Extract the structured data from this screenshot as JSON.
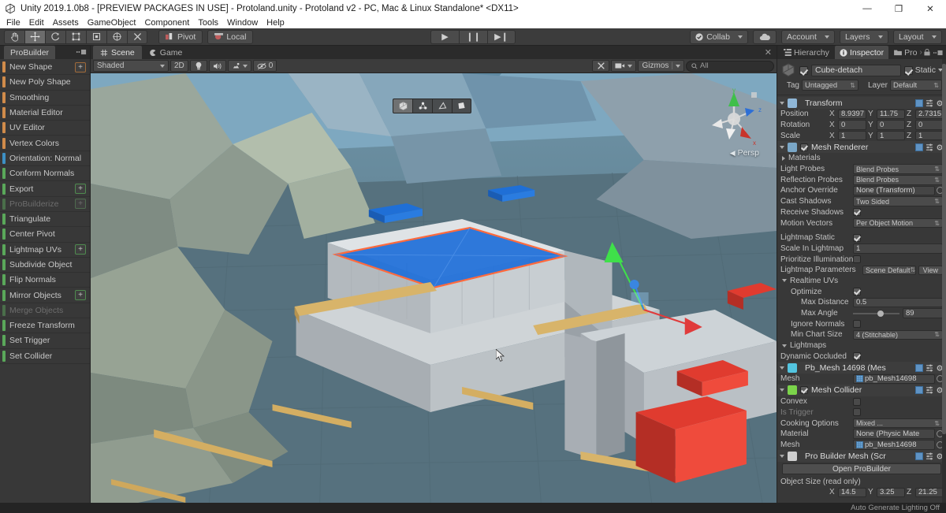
{
  "window": {
    "title": "Unity 2019.1.0b8 - [PREVIEW PACKAGES IN USE] - Protoland.unity - Protoland v2 - PC, Mac & Linux Standalone* <DX11>",
    "minimize": "—",
    "maximize": "❐",
    "close": "✕"
  },
  "menubar": {
    "items": [
      "File",
      "Edit",
      "Assets",
      "GameObject",
      "Component",
      "Tools",
      "Window",
      "Help"
    ]
  },
  "toolbar": {
    "tools": [
      {
        "name": "hand-tool",
        "glyph": "✋",
        "active": false
      },
      {
        "name": "move-tool",
        "glyph": "✥",
        "active": true
      },
      {
        "name": "rotate-tool",
        "glyph": "↻",
        "active": false
      },
      {
        "name": "scale-tool",
        "glyph": "⤢",
        "active": false
      },
      {
        "name": "rect-tool",
        "glyph": "▣",
        "active": false
      },
      {
        "name": "transform-tool",
        "glyph": "⌖",
        "active": false
      },
      {
        "name": "custom-editor-tool",
        "glyph": "⚒",
        "active": false
      }
    ],
    "pivot_label": "Pivot",
    "local_label": "Local",
    "play_label": "▶",
    "pause_label": "❙❙",
    "step_label": "▶❙",
    "collab_label": "Collab",
    "cloud_label": "☁",
    "account_label": "Account",
    "layers_label": "Layers",
    "layout_label": "Layout"
  },
  "probuilder": {
    "tab_label": "ProBuilder",
    "items": [
      {
        "label": "New Shape",
        "color": "#d08b4a",
        "plus": true,
        "dim": false
      },
      {
        "label": "New Poly Shape",
        "color": "#d08b4a",
        "plus": false,
        "dim": false
      },
      {
        "label": "Smoothing",
        "color": "#d08b4a",
        "plus": false,
        "dim": false
      },
      {
        "label": "Material Editor",
        "color": "#d08b4a",
        "plus": false,
        "dim": false
      },
      {
        "label": "UV Editor",
        "color": "#d08b4a",
        "plus": false,
        "dim": false
      },
      {
        "label": "Vertex Colors",
        "color": "#d08b4a",
        "plus": false,
        "dim": false
      },
      {
        "label": "Orientation: Normal",
        "color": "#3d90c4",
        "plus": false,
        "dim": false
      },
      {
        "label": "Conform Normals",
        "color": "#5aa85a",
        "plus": false,
        "dim": false
      },
      {
        "label": "Export",
        "color": "#5aa85a",
        "plus": true,
        "dim": false
      },
      {
        "label": "ProBuilderize",
        "color": "#4a6e4a",
        "plus": true,
        "dim": true
      },
      {
        "label": "Triangulate",
        "color": "#5aa85a",
        "plus": false,
        "dim": false
      },
      {
        "label": "Center Pivot",
        "color": "#5aa85a",
        "plus": false,
        "dim": false
      },
      {
        "label": "Lightmap UVs",
        "color": "#5aa85a",
        "plus": true,
        "dim": false
      },
      {
        "label": "Subdivide Object",
        "color": "#5aa85a",
        "plus": false,
        "dim": false
      },
      {
        "label": "Flip Normals",
        "color": "#5aa85a",
        "plus": false,
        "dim": false
      },
      {
        "label": "Mirror Objects",
        "color": "#5aa85a",
        "plus": true,
        "dim": false
      },
      {
        "label": "Merge Objects",
        "color": "#4a6e4a",
        "plus": false,
        "dim": true
      },
      {
        "label": "Freeze Transform",
        "color": "#5aa85a",
        "plus": false,
        "dim": false
      },
      {
        "label": "Set Trigger",
        "color": "#5aa85a",
        "plus": false,
        "dim": false
      },
      {
        "label": "Set Collider",
        "color": "#5aa85a",
        "plus": false,
        "dim": false
      }
    ]
  },
  "scene": {
    "tabs": [
      {
        "label": "Scene",
        "active": true
      },
      {
        "label": "Game",
        "active": false
      }
    ],
    "shading_mode": "Shaded",
    "mode_2d": "2D",
    "lighting_icon": "☀",
    "audio_icon": "◂))",
    "fx_icon": "☄",
    "effects_count": "0",
    "tools_icon": "⚒",
    "camera_icon": "■",
    "gizmos_label": "Gizmos",
    "search_placeholder": "All",
    "search_value": "All",
    "close_tab_icon": "✕",
    "persp_label": "Persp",
    "axis_x": "x",
    "axis_y": "y",
    "axis_z": "z",
    "element_modes": [
      {
        "name": "object-mode",
        "active": true
      },
      {
        "name": "vertex-mode",
        "active": false
      },
      {
        "name": "edge-mode",
        "active": false
      },
      {
        "name": "face-mode",
        "active": false
      }
    ]
  },
  "inspector": {
    "tabs": [
      {
        "label": "Hierarchy",
        "active": false
      },
      {
        "label": "Inspector",
        "active": true
      },
      {
        "label": "Pro",
        "active": false
      }
    ],
    "object": {
      "enabled": true,
      "name": "Cube-detach",
      "static_label": "Static",
      "static_checked": true,
      "tag_label": "Tag",
      "tag_value": "Untagged",
      "layer_label": "Layer",
      "layer_value": "Default"
    },
    "components": [
      {
        "title": "Transform",
        "icon_color": "#8fb7d8",
        "rows": [
          {
            "type": "vector3",
            "label": "Position",
            "x": "8.9397",
            "y": "11.75",
            "z": "2.7315"
          },
          {
            "type": "vector3",
            "label": "Rotation",
            "x": "0",
            "y": "0",
            "z": "0"
          },
          {
            "type": "vector3",
            "label": "Scale",
            "x": "1",
            "y": "1",
            "z": "1"
          }
        ]
      },
      {
        "title": "Mesh Renderer",
        "icon_color": "#7aa7c7",
        "has_enable": true,
        "enabled": true,
        "rows": [
          {
            "type": "foldout",
            "label": "Materials"
          },
          {
            "type": "dropdown",
            "label": "Light Probes",
            "value": "Blend Probes"
          },
          {
            "type": "dropdown",
            "label": "Reflection Probes",
            "value": "Blend Probes"
          },
          {
            "type": "object",
            "label": "Anchor Override",
            "value": "None (Transform)"
          },
          {
            "type": "dropdown",
            "label": "Cast Shadows",
            "value": "Two Sided"
          },
          {
            "type": "check",
            "label": "Receive Shadows",
            "value": true
          },
          {
            "type": "dropdown",
            "label": "Motion Vectors",
            "value": "Per Object Motion"
          },
          {
            "type": "spacer"
          },
          {
            "type": "check",
            "label": "Lightmap Static",
            "value": true
          },
          {
            "type": "text",
            "label": "Scale In Lightmap",
            "value": "1"
          },
          {
            "type": "check",
            "label": "Prioritize Illumination",
            "value": false
          },
          {
            "type": "ddview",
            "label": "Lightmap Parameters",
            "value": "Scene Default",
            "button": "View"
          },
          {
            "type": "foldout-open",
            "label": "Realtime UVs"
          },
          {
            "type": "check",
            "label": "Optimize",
            "value": true,
            "indent": 1
          },
          {
            "type": "text",
            "label": "Max Distance",
            "value": "0.5",
            "indent": 2
          },
          {
            "type": "slider",
            "label": "Max Angle",
            "value": "89",
            "indent": 2
          },
          {
            "type": "check",
            "label": "Ignore Normals",
            "value": false,
            "indent": 1
          },
          {
            "type": "dropdown",
            "label": "Min Chart Size",
            "value": "4 (Stitchable)",
            "indent": 1
          },
          {
            "type": "foldout-open",
            "label": "Lightmaps"
          },
          {
            "type": "check",
            "label": "Dynamic Occluded",
            "value": true
          }
        ]
      },
      {
        "title": "Pb_Mesh 14698 (Mes",
        "icon_color": "#53c5e0",
        "rows": [
          {
            "type": "object",
            "label": "Mesh",
            "value": "pb_Mesh14698",
            "has_mesh_icon": true
          }
        ]
      },
      {
        "title": "Mesh Collider",
        "icon_color": "#7bd44a",
        "has_enable": true,
        "enabled": true,
        "rows": [
          {
            "type": "check",
            "label": "Convex",
            "value": false
          },
          {
            "type": "check",
            "label": "Is Trigger",
            "value": false,
            "dim": true
          },
          {
            "type": "dropdown",
            "label": "Cooking Options",
            "value": "Mixed ..."
          },
          {
            "type": "object",
            "label": "Material",
            "value": "None (Physic Mate"
          },
          {
            "type": "object",
            "label": "Mesh",
            "value": "pb_Mesh14698",
            "has_mesh_icon": true
          }
        ]
      },
      {
        "title": "Pro Builder Mesh (Scr",
        "icon_color": "#cfcfcf",
        "rows": [
          {
            "type": "button",
            "label": "Open ProBuilder"
          },
          {
            "type": "label",
            "label": "Object Size (read only)"
          },
          {
            "type": "vector3-ro",
            "label": "",
            "x": "14.5",
            "y": "3.25",
            "z": "21.25"
          }
        ]
      }
    ]
  },
  "statusbar": {
    "message": "Auto Generate Lighting Off"
  }
}
